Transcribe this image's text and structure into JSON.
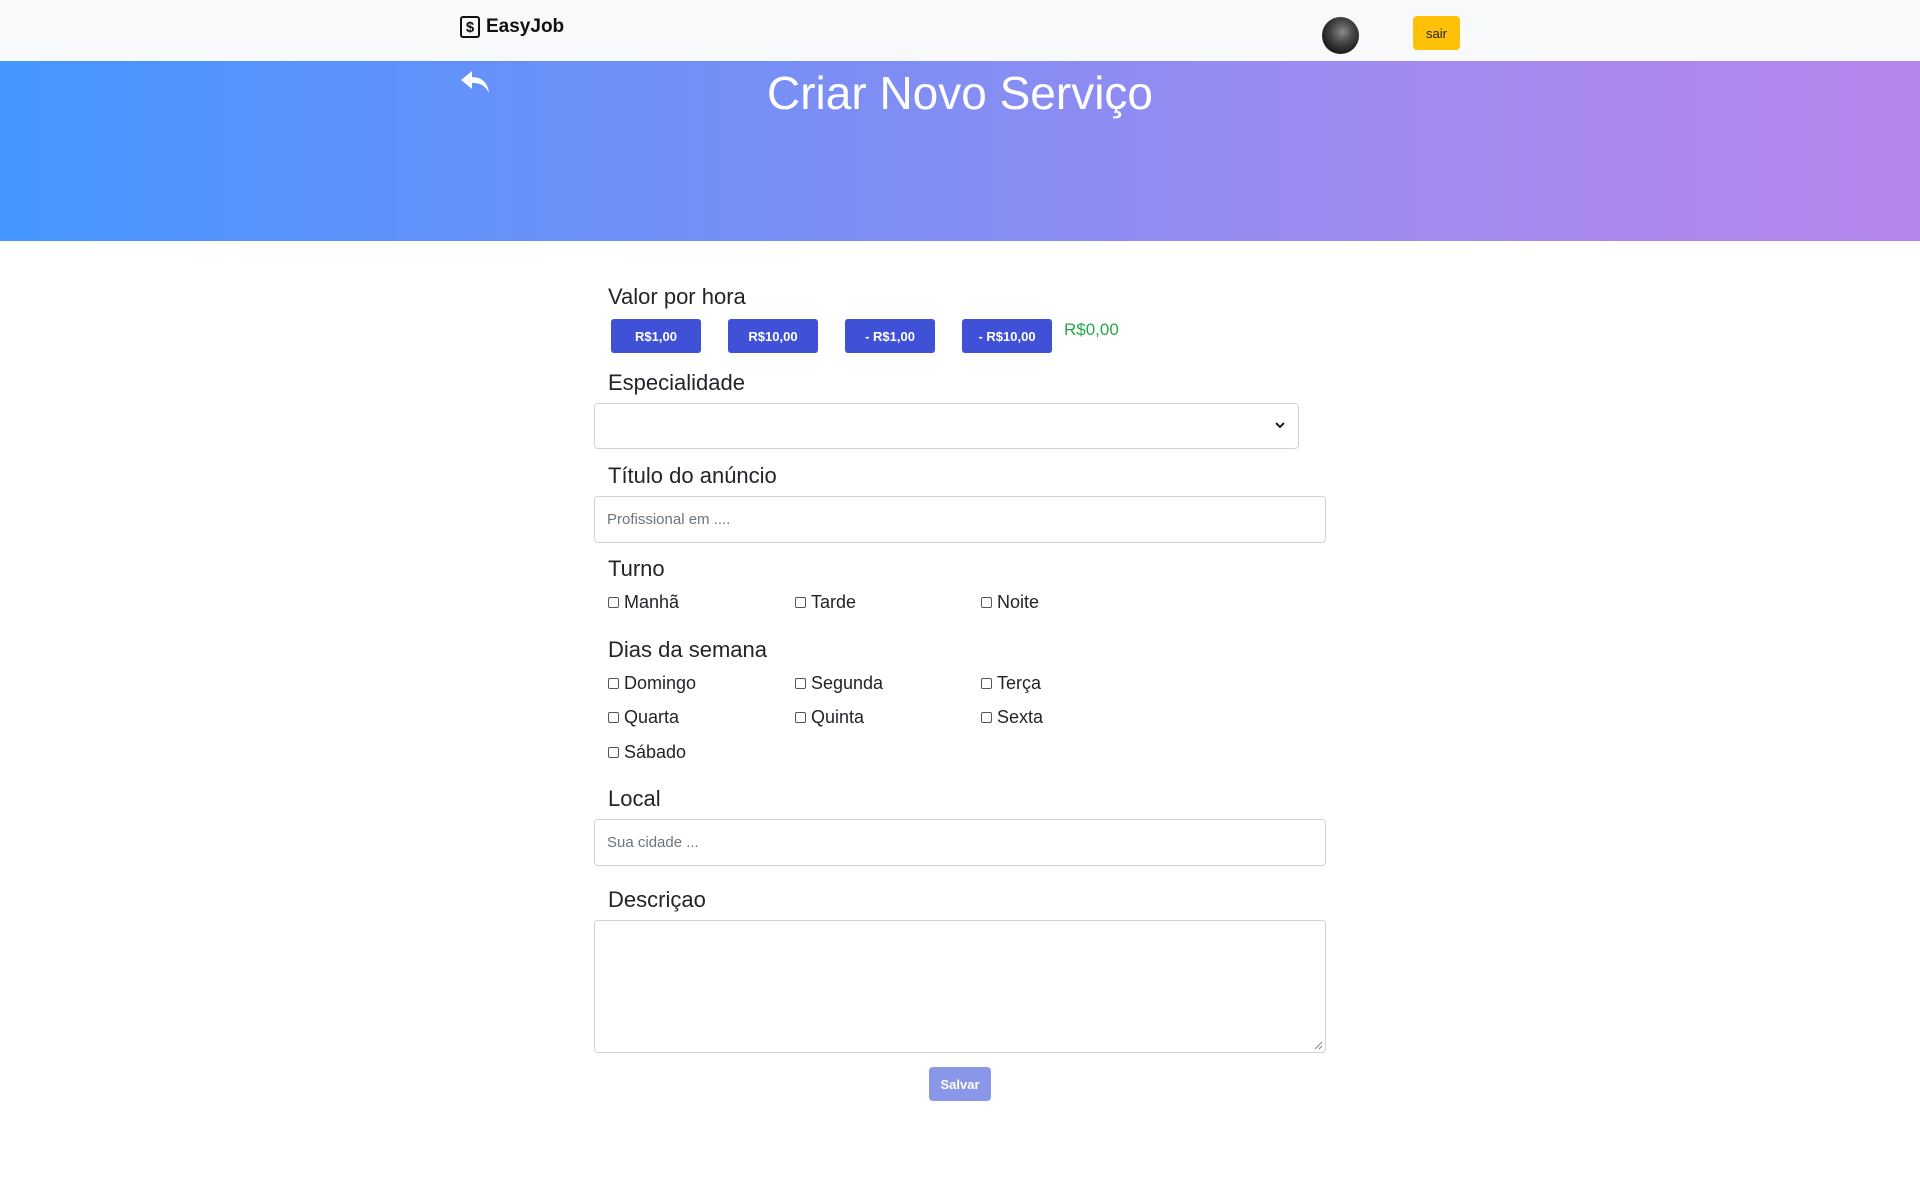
{
  "navbar": {
    "brand": "EasyJob",
    "brand_icon": "dollar-icon",
    "logout_label": "sair"
  },
  "hero": {
    "title": "Criar Novo Serviço",
    "back_icon": "reply-arrow-icon"
  },
  "form": {
    "price": {
      "label": "Valor por hora",
      "buttons": [
        "R$1,00",
        "R$10,00",
        "- R$1,00",
        "- R$10,00"
      ],
      "value": "R$0,00"
    },
    "specialty": {
      "label": "Especialidade",
      "selected": ""
    },
    "title": {
      "label": "Título do anúncio",
      "placeholder": "Profissional em ...."
    },
    "shift": {
      "label": "Turno",
      "options": [
        "Manhã",
        "Tarde",
        "Noite"
      ]
    },
    "days": {
      "label": "Dias da semana",
      "options": [
        "Domingo",
        "Segunda",
        "Terça",
        "Quarta",
        "Quinta",
        "Sexta",
        "Sábado"
      ]
    },
    "location": {
      "label": "Local",
      "placeholder": "Sua cidade ..."
    },
    "description": {
      "label": "Descriçao"
    },
    "save_label": "Salvar"
  },
  "colors": {
    "accent": "#3f51d6",
    "logout": "#ffc107",
    "price_value": "#28a745",
    "save": "#8a97e8",
    "hero_gradient": [
      "#4596ff",
      "#b586ec"
    ]
  }
}
